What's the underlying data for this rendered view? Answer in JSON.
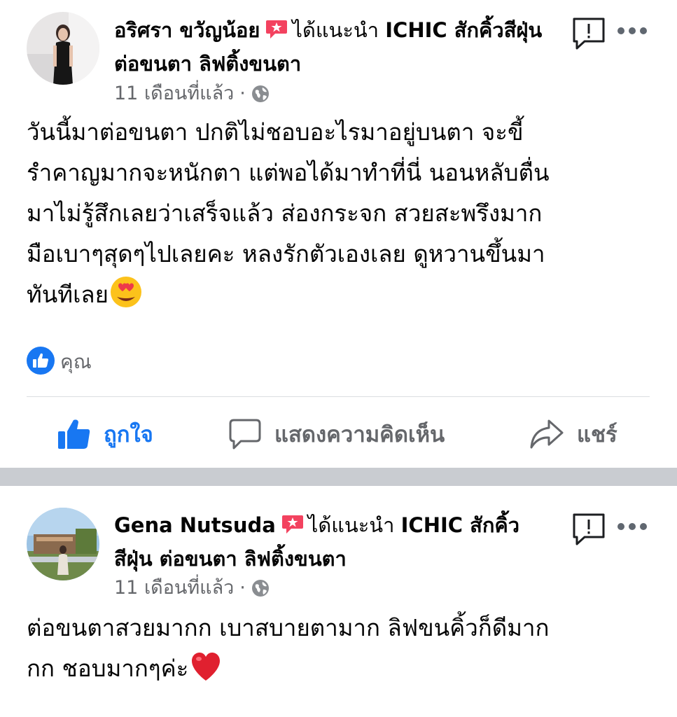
{
  "posts": [
    {
      "author": "อริศรา ขวัญน้อย",
      "recommend_text": "ได้แนะนำ ICHIC สักคิ้วสีฝุ่น ต่อขนตา ลิฟติ้งขนตา",
      "time": "11 เดือนที่แล้ว",
      "audience_icon": "globe-icon",
      "body": "วันนี้มาต่อขนตา ปกติไม่ชอบอะไรมาอยู่บนตา จะขี้รำคาญมากจะหนักตา แต่พอได้มาทำที่นี่ นอนหลับตื่นมาไม่รู้สึกเลยว่าเสร็จแล้ว ส่องกระจก สวยสะพรึงมาก มือเบาๆสุดๆไปเลยคะ หลงรักตัวเองเลย ดูหวานขึ้นมาทันทีเลย",
      "body_emoji": "heart-eyes-emoji",
      "reaction_label": "คุณ",
      "actions": {
        "like": "ถูกใจ",
        "comment": "แสดงความคิดเห็น",
        "share": "แชร์"
      }
    },
    {
      "author": "Gena Nutsuda",
      "recommend_text": "ได้แนะนำ ICHIC สักคิ้วสีฝุ่น ต่อขนตา ลิฟติ้งขนตา",
      "time": "11 เดือนที่แล้ว",
      "audience_icon": "globe-icon",
      "body": "ต่อขนตาสวยมากก เบาสบายตามาก ลิฟขนคิ้วก็ดีมากกก ชอบมากๆค่ะ",
      "body_emoji": "red-heart-emoji"
    }
  ],
  "colors": {
    "accent": "#1877f2",
    "recommend": "#f3425f",
    "secondary_text": "#65676b",
    "separator": "#c9ccd1"
  }
}
